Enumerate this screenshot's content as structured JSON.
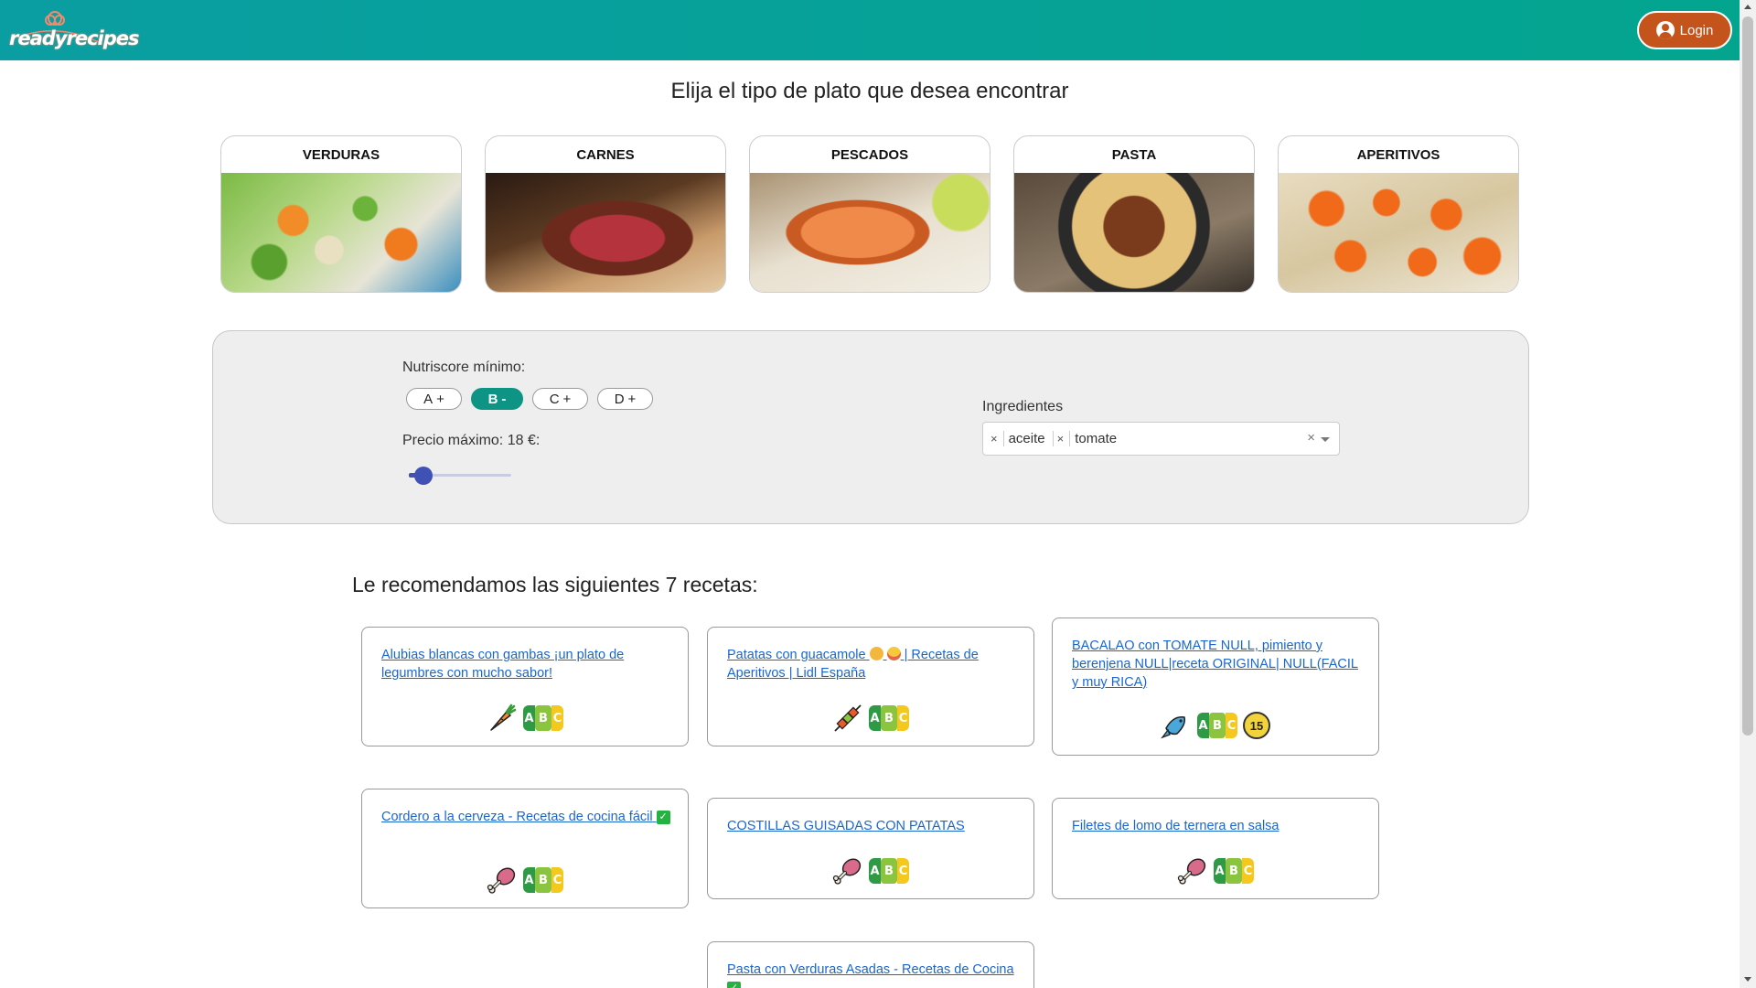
{
  "header": {
    "logo_ready": "ready",
    "logo_recipes": "recipes",
    "login_label": "Login",
    "brand_color": "#03a58f",
    "login_color": "#c5541c"
  },
  "page_title": "Elija el tipo de plato que desea encontrar",
  "categories": [
    {
      "label": "VERDURAS",
      "image": "vegetables-photo"
    },
    {
      "label": "CARNES",
      "image": "steak-photo"
    },
    {
      "label": "PESCADOS",
      "image": "salmon-photo"
    },
    {
      "label": "PASTA",
      "image": "spaghetti-photo"
    },
    {
      "label": "APERITIVOS",
      "image": "canapes-photo"
    }
  ],
  "filters": {
    "nutriscore_label": "Nutriscore mínimo:",
    "nutriscore_options": [
      {
        "letter": "A",
        "sign": "+",
        "selected": false
      },
      {
        "letter": "B",
        "sign": "-",
        "selected": true
      },
      {
        "letter": "C",
        "sign": "+",
        "selected": false
      },
      {
        "letter": "D",
        "sign": "+",
        "selected": false
      }
    ],
    "price_label": "Precio máximo: 18 €:",
    "price_slider_fraction": 0.14,
    "ingredients_label": "Ingredientes",
    "ingredients_selected": [
      "aceite",
      "tomate"
    ],
    "chip_remove": "×",
    "clear_icon": "×"
  },
  "recommendations_title": "Le recomendamos las siguientes 7 recetas:",
  "recipes": [
    {
      "title": "Alubias blancas con gambas ¡un plato de legumbres con mucho sabor!",
      "icon": "carrot-icon",
      "nutriscore": "B"
    },
    {
      "title": "Patatas con guacamole",
      "title_tail": " | Recetas de Aperitivos | Lidl España",
      "icon": "skewer-icon",
      "nutriscore": "B"
    },
    {
      "title": "BACALAO con TOMATE NULL, pimiento y berenjena NULL|receta ORIGINAL| NULL(FACIL y muy RICA)",
      "icon": "fish-icon",
      "nutriscore": "B",
      "price": "15"
    },
    {
      "title": "Cordero a la cerveza - Recetas de cocina fácil",
      "icon": "drumstick-icon",
      "nutriscore": "B",
      "check": "✓"
    },
    {
      "title": "COSTILLAS GUISADAS CON PATATAS",
      "icon": "drumstick-icon",
      "nutriscore": "B"
    },
    {
      "title": "Filetes de lomo de ternera en salsa",
      "icon": "drumstick-icon",
      "nutriscore": "B"
    },
    {
      "title": "Pasta con Verduras Asadas - Recetas de Cocina",
      "check": "✓"
    }
  ],
  "nutri_badge": {
    "a": "A",
    "b": "B",
    "c": "C"
  }
}
